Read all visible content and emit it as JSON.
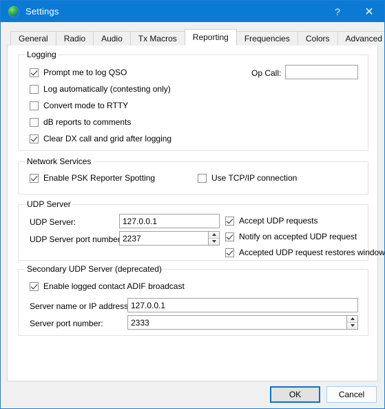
{
  "window": {
    "title": "Settings",
    "icon": "globe-icon",
    "help_label": "?",
    "close_label": "✕",
    "titlebar_color": "#0b7ad4"
  },
  "tabs": [
    {
      "label": "General",
      "selected": false
    },
    {
      "label": "Radio",
      "selected": false
    },
    {
      "label": "Audio",
      "selected": false
    },
    {
      "label": "Tx Macros",
      "selected": false
    },
    {
      "label": "Reporting",
      "selected": true
    },
    {
      "label": "Frequencies",
      "selected": false
    },
    {
      "label": "Colors",
      "selected": false
    },
    {
      "label": "Advanced",
      "selected": false
    }
  ],
  "logging": {
    "legend": "Logging",
    "checkboxes": [
      {
        "label": "Prompt me to log QSO",
        "checked": true
      },
      {
        "label": "Log automatically (contesting only)",
        "checked": false
      },
      {
        "label": "Convert mode to RTTY",
        "checked": false
      },
      {
        "label": "dB reports to comments",
        "checked": false
      },
      {
        "label": "Clear DX call and grid after logging",
        "checked": true
      }
    ],
    "op_call_label": "Op Call:",
    "op_call_value": "",
    "op_call_placeholder": ""
  },
  "network_services": {
    "legend": "Network Services",
    "checkboxes": [
      {
        "label": "Enable PSK Reporter Spotting",
        "checked": true
      },
      {
        "label": "Use TCP/IP connection",
        "checked": false
      }
    ]
  },
  "udp_server": {
    "legend": "UDP Server",
    "server_label": "UDP Server:",
    "server_value": "127.0.0.1",
    "port_label": "UDP Server port number:",
    "port_value": "2237",
    "checkboxes": [
      {
        "label": "Accept UDP requests",
        "checked": true
      },
      {
        "label": "Notify on accepted UDP request",
        "checked": true
      },
      {
        "label": "Accepted UDP request restores window",
        "checked": true
      }
    ]
  },
  "secondary_udp_server": {
    "legend": "Secondary UDP Server (deprecated)",
    "enable_label": "Enable logged contact ADIF broadcast",
    "enable_checked": true,
    "server_label": "Server name or IP address:",
    "server_value": "127.0.0.1",
    "port_label": "Server port number:",
    "port_value": "2333"
  },
  "buttons": {
    "ok": "OK",
    "cancel": "Cancel"
  }
}
